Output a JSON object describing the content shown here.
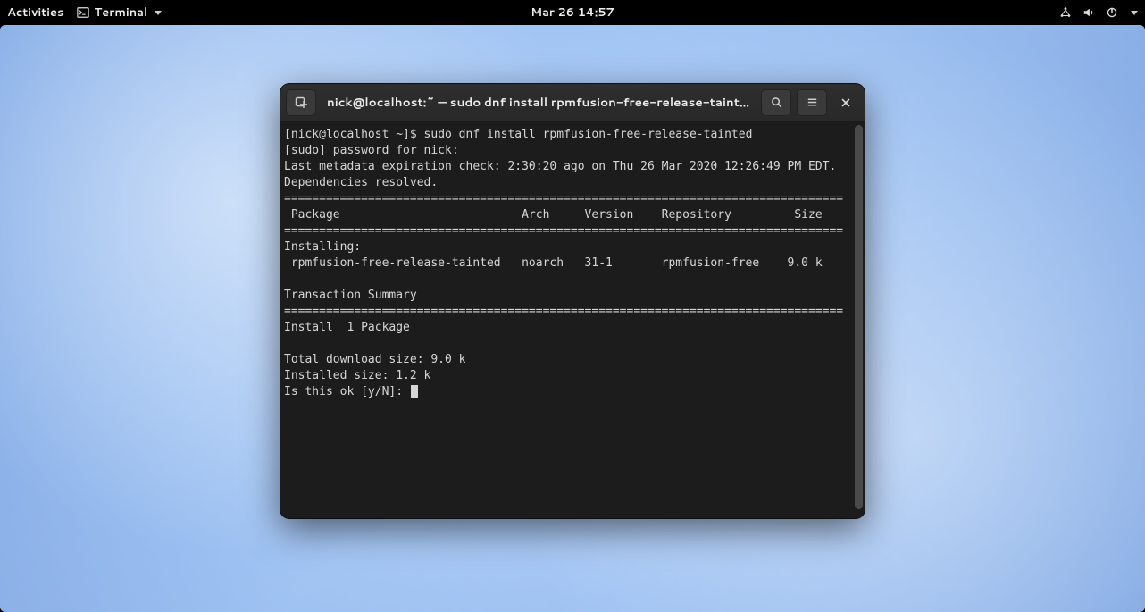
{
  "topbar": {
    "activities": "Activities",
    "app_name": "Terminal",
    "datetime": "Mar 26  14:57"
  },
  "window": {
    "title": "nick@localhost:~ — sudo dnf install rpmfusion-free-release-taint…"
  },
  "terminal": {
    "prompt": "[nick@localhost ~]$ ",
    "command": "sudo dnf install rpmfusion-free-release-tainted",
    "sudo_prompt": "[sudo] password for nick: ",
    "metadata_line": "Last metadata expiration check: 2:30:20 ago on Thu 26 Mar 2020 12:26:49 PM EDT.",
    "deps_resolved": "Dependencies resolved.",
    "rule": "================================================================================",
    "header": " Package                          Arch     Version    Repository         Size",
    "installing_label": "Installing:",
    "pkg_row": " rpmfusion-free-release-tainted   noarch   31-1       rpmfusion-free    9.0 k",
    "txn_summary": "Transaction Summary",
    "install_count": "Install  1 Package",
    "total_dl": "Total download size: 9.0 k",
    "installed_size": "Installed size: 1.2 k",
    "confirm_prompt": "Is this ok [y/N]: "
  }
}
